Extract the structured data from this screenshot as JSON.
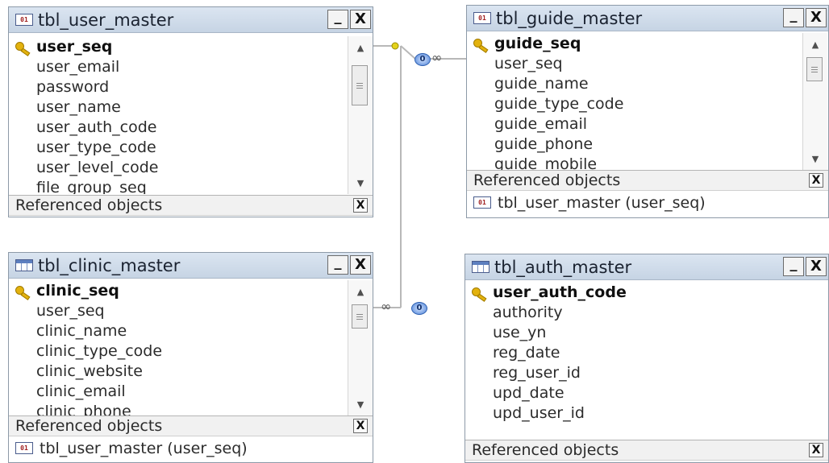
{
  "tables": {
    "user_master": {
      "title": "tbl_user_master",
      "fields": [
        "user_seq",
        "user_email",
        "password",
        "user_name",
        "user_auth_code",
        "user_type_code",
        "user_level_code",
        "file_group_seq"
      ],
      "referenced_label": "Referenced objects"
    },
    "guide_master": {
      "title": "tbl_guide_master",
      "fields": [
        "guide_seq",
        "user_seq",
        "guide_name",
        "guide_type_code",
        "guide_email",
        "guide_phone",
        "guide_mobile"
      ],
      "referenced_label": "Referenced objects",
      "referenced_items": [
        "tbl_user_master (user_seq)"
      ]
    },
    "clinic_master": {
      "title": "tbl_clinic_master",
      "fields": [
        "clinic_seq",
        "user_seq",
        "clinic_name",
        "clinic_type_code",
        "clinic_website",
        "clinic_email",
        "clinic_phone"
      ],
      "referenced_label": "Referenced objects",
      "referenced_items": [
        "tbl_user_master (user_seq)"
      ]
    },
    "auth_master": {
      "title": "tbl_auth_master",
      "fields": [
        "user_auth_code",
        "authority",
        "use_yn",
        "reg_date",
        "reg_user_id",
        "upd_date",
        "upd_user_id"
      ],
      "referenced_label": "Referenced objects"
    }
  },
  "buttons": {
    "minimize": "_",
    "close": "X",
    "ref_close": "X"
  },
  "relationships": {
    "one_marker": "0",
    "many_marker": "∞"
  },
  "icons": {
    "referenced_table": "table-reference-icon",
    "plain_table": "table-grid-icon",
    "primary_key": "key-icon"
  }
}
